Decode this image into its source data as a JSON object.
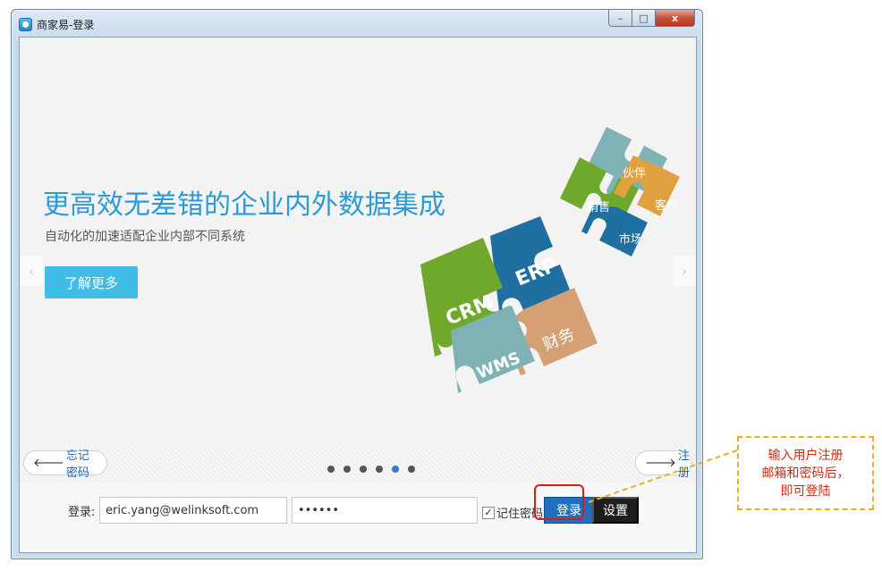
{
  "window": {
    "title": "商家易-登录",
    "controls": {
      "minimize": "–",
      "maximize": "□",
      "close": "x"
    }
  },
  "banner": {
    "headline": "更高效无差错的企业内外数据集成",
    "subline": "自动化的加速适配企业内部不同系统",
    "learn_more": "了解更多",
    "prev_arrow": "‹",
    "next_arrow": "›",
    "puzzle_pieces": [
      "CRM",
      "ERP",
      "WMS",
      "财务",
      "伙伴",
      "销售",
      "客户",
      "市场"
    ],
    "colors": {
      "green": "#6fa82a",
      "blue": "#1f6fa0",
      "teal": "#7fb2b5",
      "tan": "#d6a075",
      "orange": "#e0a040",
      "accent": "#2b9ad8"
    }
  },
  "controls": {
    "forgot_arrow": "🡐",
    "forgot_label": "忘记密码",
    "register_arrow": "🡒",
    "register_label": "注册",
    "carousel": {
      "count": 6,
      "active_index": 4
    }
  },
  "login": {
    "label": "登录:",
    "username": "eric.yang@welinksoft.com",
    "password": "••••••",
    "remember_checked": "✓",
    "remember_label": "记住密码",
    "login_button": "登录",
    "settings_button": "设置"
  },
  "annotation": {
    "line1": "输入用户注册",
    "line2": "邮箱和密码后，",
    "line3": "即可登陆"
  }
}
